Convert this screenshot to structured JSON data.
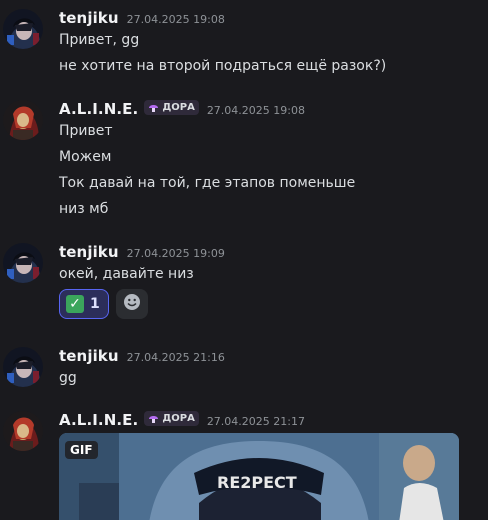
{
  "messages": [
    {
      "author": "tenjiku",
      "time": "27.04.2025 19:08",
      "lines": [
        "Привет, gg",
        "не хотите на второй подраться ещё разок?)"
      ]
    },
    {
      "author": "A.L.I.N.E.",
      "tag": "ДОРА",
      "time": "27.04.2025 19:08",
      "lines": [
        "Привет",
        "Можем",
        "Ток давай на той, где этапов поменьше",
        "низ мб"
      ]
    },
    {
      "author": "tenjiku",
      "time": "27.04.2025 19:09",
      "lines": [
        "окей, давайте низ"
      ],
      "reaction": {
        "emoji": "check-mark",
        "count": "1"
      }
    },
    {
      "author": "tenjiku",
      "time": "27.04.2025 21:16",
      "lines": [
        "gg"
      ]
    },
    {
      "author": "A.L.I.N.E.",
      "tag": "ДОРА",
      "time": "27.04.2025 21:17",
      "gif": {
        "badge": "GIF",
        "cap_text": "RE2PECT"
      }
    }
  ],
  "colors": {
    "background": "#1a1a1e",
    "author": "#f2f3f5",
    "text": "#dbdee1",
    "timestamp": "#8e9297",
    "reaction_active_border": "#5865f2"
  }
}
